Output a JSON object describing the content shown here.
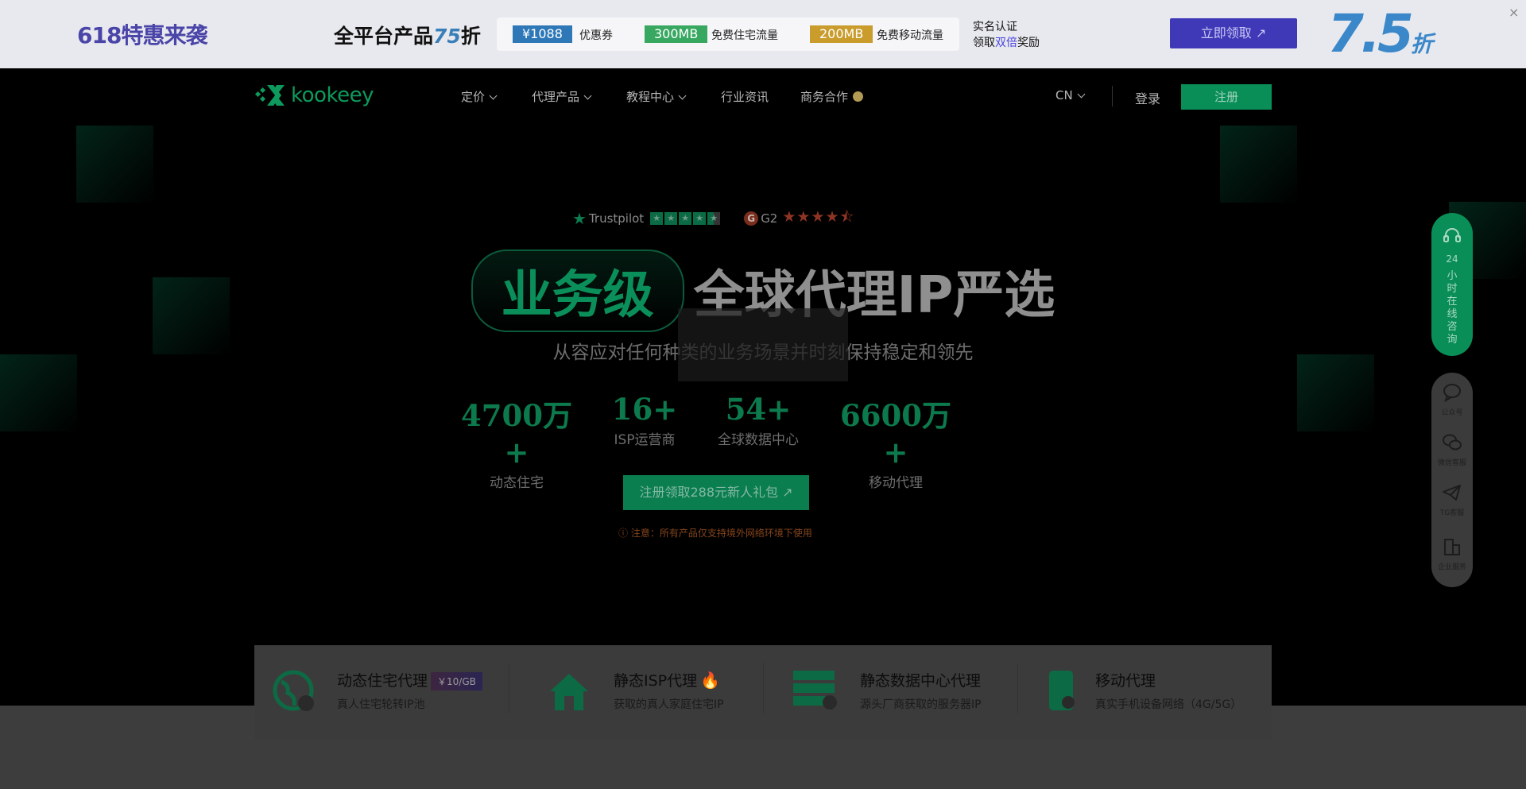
{
  "promo": {
    "title": "618特惠来袭",
    "sub_text": "全平台产品",
    "sub_highlight": "75",
    "sub_suffix": "折",
    "chips": [
      {
        "value": "¥1088",
        "label": "优惠券",
        "color": "#2e78b7"
      },
      {
        "value": "300MB",
        "label": "免费住宅流量",
        "color": "#38a861"
      },
      {
        "value": "200MB",
        "label": "免费移动流量",
        "color": "#c99c2c"
      }
    ],
    "verify_line1": "实名认证",
    "verify_line2_a": "领取",
    "verify_line2_b": "双倍",
    "verify_line2_c": "奖励",
    "claim_button": "立即领取 ↗",
    "big_discount": "7.5",
    "big_discount_suffix": "折",
    "close": "×"
  },
  "nav": {
    "logo": "kookeey",
    "items": [
      {
        "label": "定价",
        "dropdown": true
      },
      {
        "label": "代理产品",
        "dropdown": true
      },
      {
        "label": "教程中心",
        "dropdown": true
      },
      {
        "label": "行业资讯",
        "dropdown": false
      },
      {
        "label": "商务合作",
        "dropdown": false
      }
    ],
    "language": "CN",
    "login": "登录",
    "register": "注册"
  },
  "hero": {
    "trustpilot_label": "Trustpilot",
    "g2_label": "G2",
    "g2_icon": "G",
    "headline_pill": "业务级",
    "headline_rest": "全球代理IP严选",
    "subtitle": "从容应对任何种类的业务场景并时刻保持稳定和领先",
    "stats": [
      {
        "value": "4700万+",
        "label": "动态住宅"
      },
      {
        "value": "16+",
        "label": "ISP运营商"
      },
      {
        "value": "54+",
        "label": "全球数据中心"
      },
      {
        "value": "6600万+",
        "label": "移动代理"
      }
    ],
    "cta": "注册领取288元新人礼包 ↗",
    "notice": "ⓘ 注意：所有产品仅支持境外网络环境下使用"
  },
  "side": {
    "consult_number": "24",
    "consult_text": "小时在线咨询",
    "items": [
      {
        "label": "公众号",
        "icon": "chat-bubble-icon"
      },
      {
        "label": "微信客服",
        "icon": "wechat-icon"
      },
      {
        "label": "TG客服",
        "icon": "telegram-icon"
      },
      {
        "label": "企业服务",
        "icon": "building-icon"
      }
    ]
  },
  "products": [
    {
      "title": "动态住宅代理",
      "desc": "真人住宅轮转IP池",
      "tag": "￥10/GB",
      "icon": "globe-icon"
    },
    {
      "title": "静态ISP代理",
      "desc": "获取的真人家庭住宅IP",
      "tag": "",
      "icon": "house-icon"
    },
    {
      "title": "静态数据中心代理",
      "desc": "源头厂商获取的服务器IP",
      "tag": "",
      "icon": "server-icon"
    },
    {
      "title": "移动代理",
      "desc": "真实手机设备网络（4G/5G）",
      "tag": "",
      "icon": "phone-icon"
    }
  ],
  "colors": {
    "brand_green": "#0a8e57",
    "promo_purple": "#3f39b8",
    "overlay": "#000000"
  }
}
